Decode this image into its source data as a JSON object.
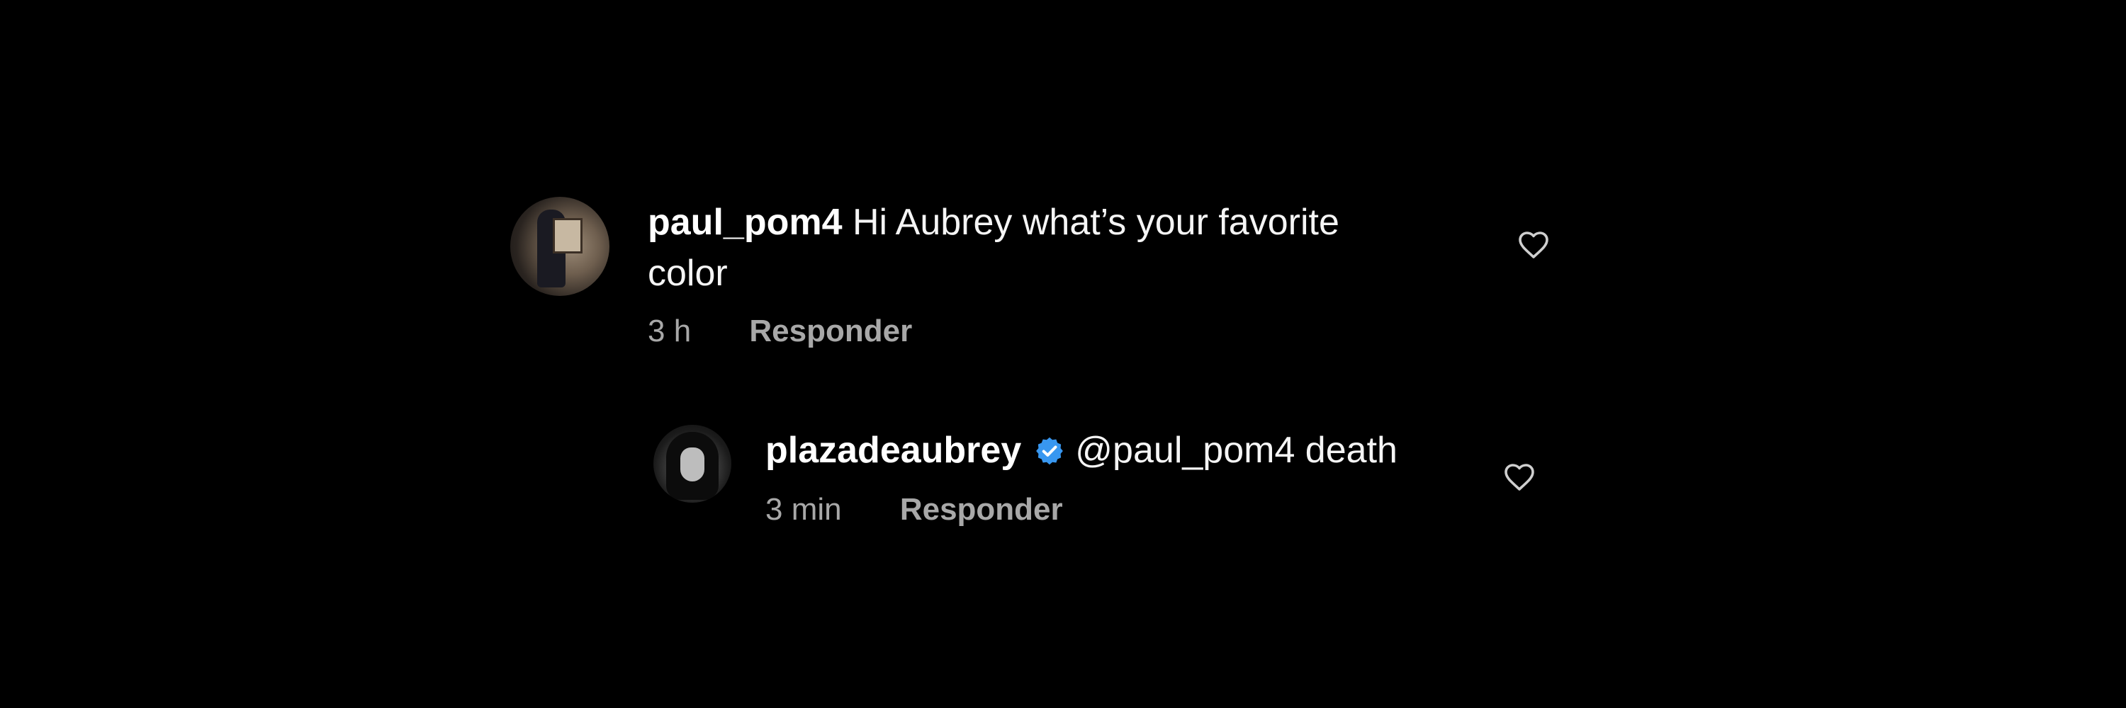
{
  "comments": [
    {
      "username": "paul_pom4",
      "text": "Hi Aubrey what’s your favorite color",
      "time": "3 h",
      "reply_label": "Responder",
      "like_icon": "heart-outline-icon"
    }
  ],
  "replies": [
    {
      "username": "plazadeaubrey",
      "verified": true,
      "verified_icon": "verified-badge-icon",
      "verified_color": "#3897f0",
      "text": "@paul_pom4 death",
      "time": "3 min",
      "reply_label": "Responder",
      "like_icon": "heart-outline-icon"
    }
  ],
  "colors": {
    "background": "#000000",
    "text": "#f5f5f5",
    "meta": "#a8a8a8"
  }
}
